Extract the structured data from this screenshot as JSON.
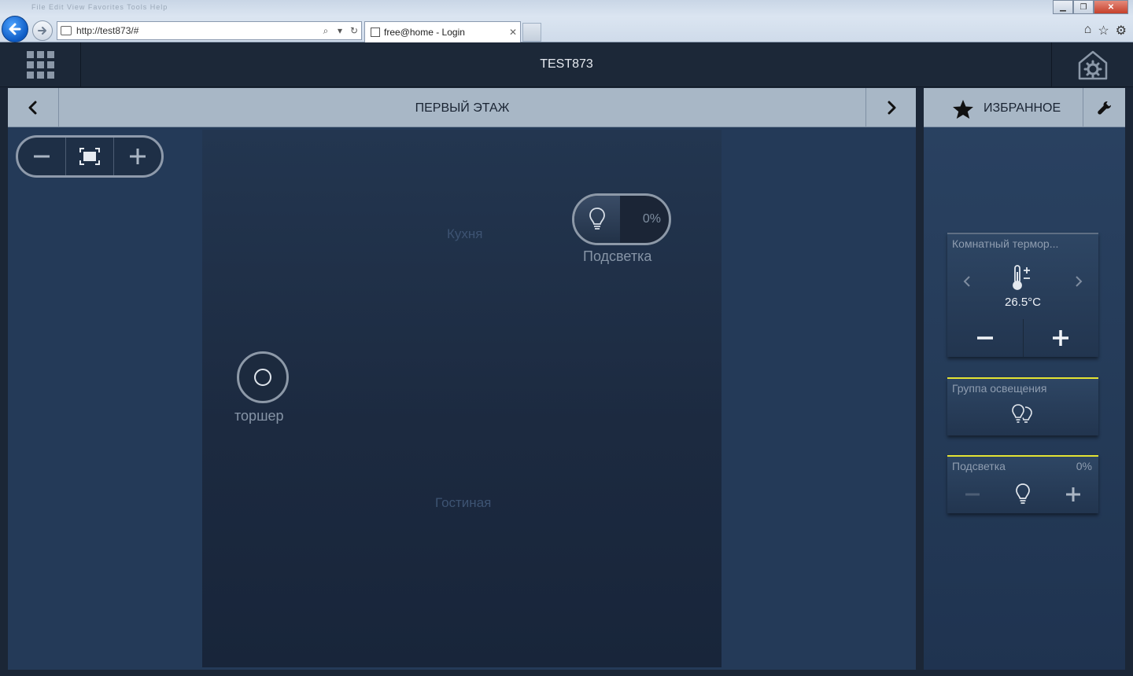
{
  "browser": {
    "url": "http://test873/#",
    "tab_title": "free@home - Login",
    "tab_close": "✕",
    "menu_items": "File  Edit  View  Favorites  Tools  Help"
  },
  "header": {
    "title": "TEST873"
  },
  "floor": {
    "title": "ПЕРВЫЙ ЭТАЖ",
    "rooms": [
      "Кухня",
      "Гостиная"
    ],
    "dimmer": {
      "label": "Подсветка",
      "value": "0%"
    },
    "switch": {
      "label": "торшер"
    }
  },
  "favorites": {
    "title": "ИЗБРАННОЕ",
    "thermostat": {
      "title": "Комнатный термор...",
      "temperature": "26.5°C"
    },
    "light_group": {
      "title": "Группа освещения"
    },
    "dimmer": {
      "title": "Подсветка",
      "value": "0%"
    }
  },
  "colors": {
    "accent_active": "#e4e333",
    "panel_header": "#a8b7c6",
    "app_header": "#1c2838"
  },
  "icons": [
    "back-arrow-icon",
    "forward-arrow-icon",
    "search-icon",
    "refresh-icon",
    "home-icon",
    "star-icon",
    "gear-icon",
    "apps-grid-icon",
    "home-settings-icon",
    "chevron-left-icon",
    "chevron-right-icon",
    "zoom-out-icon",
    "fit-screen-icon",
    "zoom-in-icon",
    "bulb-icon",
    "thermometer-icon",
    "bulb-group-icon",
    "wrench-icon"
  ]
}
